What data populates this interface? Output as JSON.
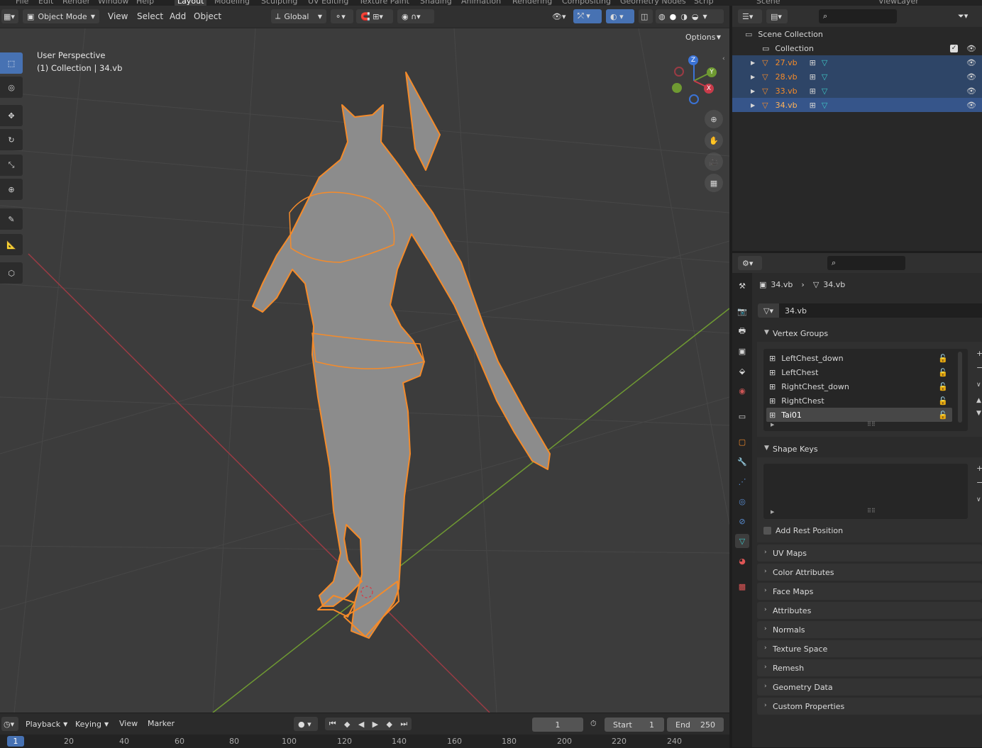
{
  "top_menus": [
    "File",
    "Edit",
    "Render",
    "Window",
    "Help",
    "Layout",
    "Modeling",
    "Sculpting",
    "UV Editing",
    "Texture Paint",
    "Shading",
    "Animation",
    "Rendering",
    "Compositing",
    "Geometry Nodes",
    "Scrip",
    "Scene",
    "ViewLayer"
  ],
  "viewport_header": {
    "mode": "Object Mode",
    "menus": [
      "View",
      "Select",
      "Add",
      "Object"
    ],
    "transform_orientation": "Global",
    "options": "Options"
  },
  "viewport": {
    "perspective": "User Perspective",
    "collection_info": "(1) Collection | 34.vb",
    "gizmo": {
      "z": "Z",
      "y": "Y",
      "x": "X"
    },
    "icons": [
      "select-box-icon",
      "cursor-icon",
      "move-icon",
      "rotate-icon",
      "scale-icon",
      "transform-icon",
      "annotate-icon",
      "measure-icon",
      "add-cube-icon"
    ]
  },
  "timeline": {
    "menus": [
      "Playback",
      "Keying",
      "View",
      "Marker"
    ],
    "current_frame": "1",
    "start_label": "Start",
    "start_value": "1",
    "end_label": "End",
    "end_value": "250",
    "ruler": [
      "1",
      "20",
      "40",
      "60",
      "80",
      "100",
      "120",
      "140",
      "160",
      "180",
      "200",
      "220",
      "240"
    ]
  },
  "outliner": {
    "scene_collection": "Scene Collection",
    "collection": "Collection",
    "objects": [
      {
        "name": "27.vb",
        "selected": true,
        "active": false
      },
      {
        "name": "28.vb",
        "selected": true,
        "active": false
      },
      {
        "name": "33.vb",
        "selected": true,
        "active": false
      },
      {
        "name": "34.vb",
        "selected": true,
        "active": true
      }
    ]
  },
  "properties": {
    "breadcrumb_object": "34.vb",
    "breadcrumb_data": "34.vb",
    "mesh_name": "34.vb",
    "vertex_groups_title": "Vertex Groups",
    "vertex_groups": [
      "LeftChest_down",
      "LeftChest",
      "RightChest_down",
      "RightChest",
      "Tai01"
    ],
    "active_vertex_group": "Tai01",
    "shape_keys_title": "Shape Keys",
    "add_rest_position": "Add Rest Position",
    "collapsed_panels": [
      "UV Maps",
      "Color Attributes",
      "Face Maps",
      "Attributes",
      "Normals",
      "Texture Space",
      "Remesh",
      "Geometry Data",
      "Custom Properties"
    ]
  },
  "colors": {
    "accent": "#4772b3",
    "selection_orange": "#f58b2a",
    "x_axis": "#9b3b44",
    "y_axis": "#6f9a32",
    "z_axis": "#3b73d6"
  }
}
